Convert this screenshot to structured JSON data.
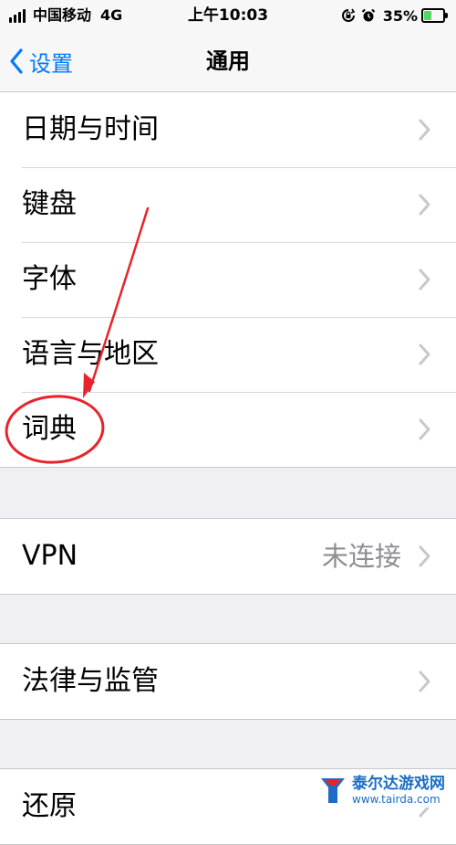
{
  "status_bar": {
    "carrier": "中国移动",
    "network": "4G",
    "time": "上午10:03",
    "battery_percent": "35%",
    "battery_level": 0.35,
    "icons": [
      "signal-icon",
      "orientation-lock-icon",
      "alarm-icon",
      "battery-charging-icon"
    ]
  },
  "nav": {
    "back_label": "设置",
    "title": "通用",
    "back_icon": "chevron-left-icon"
  },
  "groups": [
    {
      "rows": [
        {
          "label": "日期与时间"
        },
        {
          "label": "键盘"
        },
        {
          "label": "字体"
        },
        {
          "label": "语言与地区"
        },
        {
          "label": "词典"
        }
      ]
    },
    {
      "rows": [
        {
          "label": "VPN",
          "value": "未连接"
        }
      ]
    },
    {
      "rows": [
        {
          "label": "法律与监管"
        }
      ]
    },
    {
      "rows": [
        {
          "label": "还原"
        }
      ]
    }
  ],
  "colors": {
    "accent": "#007aff",
    "annotation": "#e8232b",
    "battery": "#4cd964",
    "background": "#efeff4"
  },
  "watermark": {
    "name": "泰尔达游戏网",
    "url": "www.tairda.com"
  }
}
